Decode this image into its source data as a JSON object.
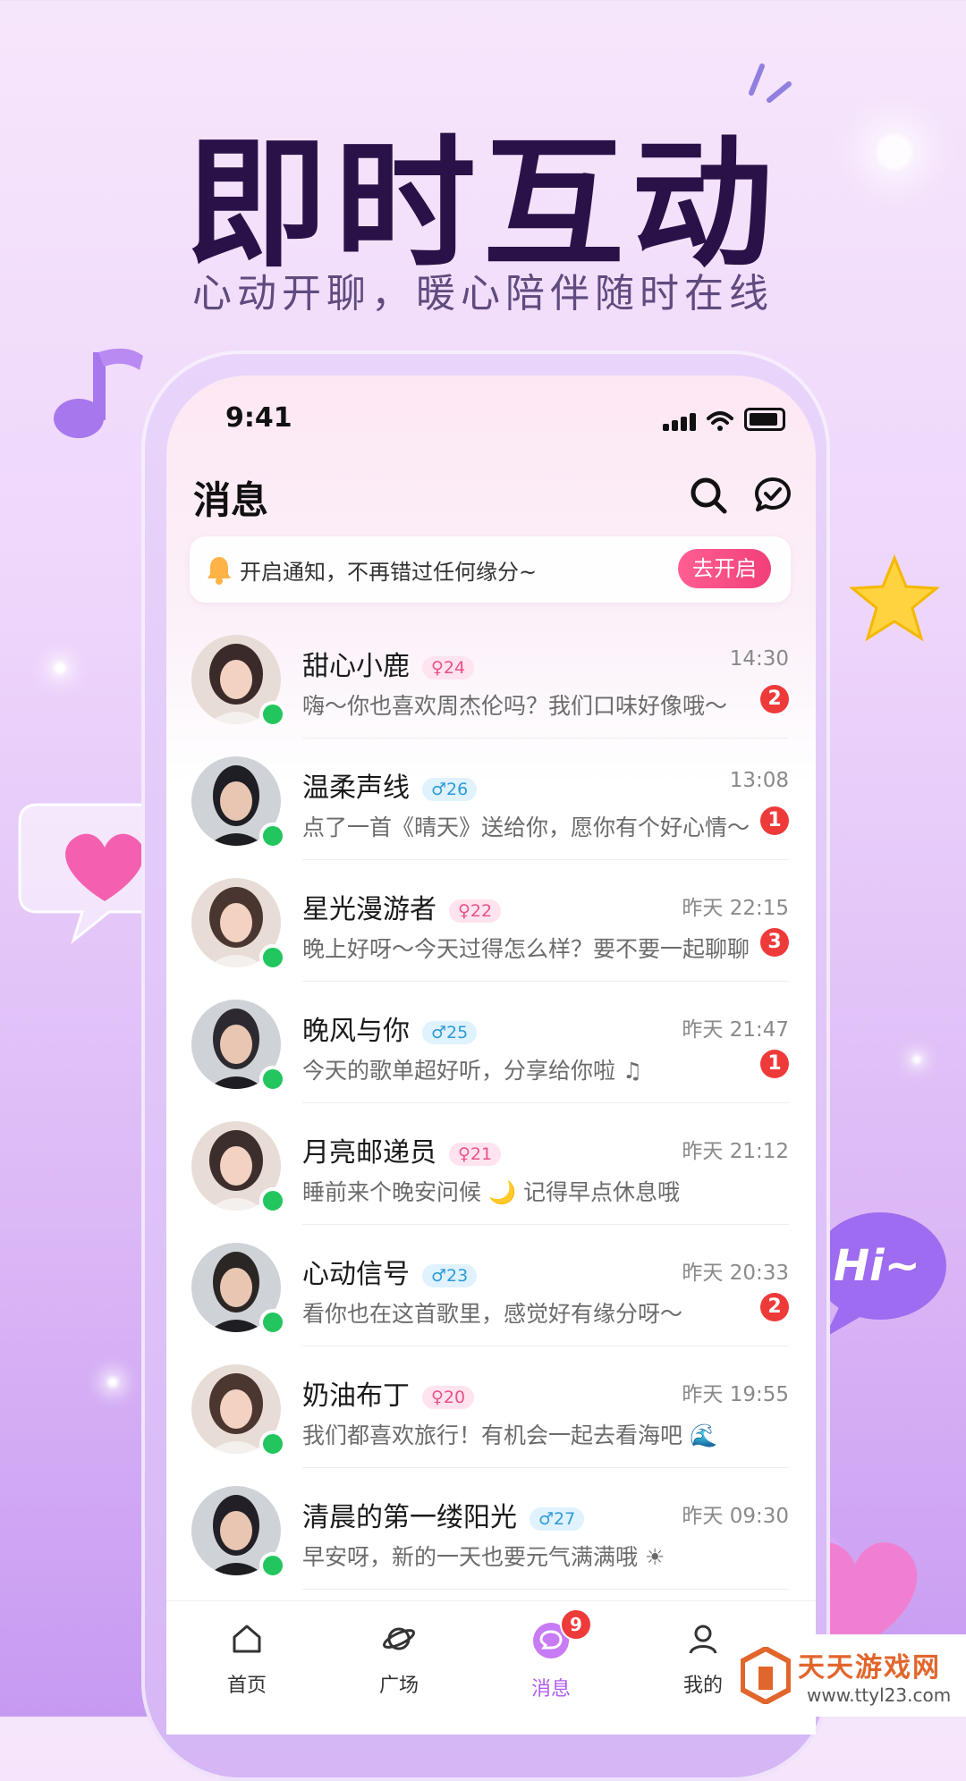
{
  "hero": {
    "title": "即时互动",
    "subtitle": "心动开聊，暖心陪伴随时在线"
  },
  "status_bar": {
    "time": "9:41"
  },
  "header": {
    "title": "消息"
  },
  "notice": {
    "text": "开启通知，不再错过任何缘分~",
    "button": "去开启"
  },
  "conversations": [
    {
      "name": "甜心小鹿",
      "gender": "female",
      "age": "24",
      "message": "嗨～你也喜欢周杰伦吗？我们口味好像哦～",
      "time": "14:30",
      "unread": "2"
    },
    {
      "name": "温柔声线",
      "gender": "male",
      "age": "26",
      "message": "点了一首《晴天》送给你，愿你有个好心情～",
      "time": "13:08",
      "unread": "1"
    },
    {
      "name": "星光漫游者",
      "gender": "female",
      "age": "22",
      "message": "晚上好呀～今天过得怎么样？要不要一起聊聊",
      "time": "昨天 22:15",
      "unread": "3"
    },
    {
      "name": "晚风与你",
      "gender": "male",
      "age": "25",
      "message": "今天的歌单超好听，分享给你啦 ♫",
      "time": "昨天 21:47",
      "unread": "1"
    },
    {
      "name": "月亮邮递员",
      "gender": "female",
      "age": "21",
      "message": "睡前来个晚安问候 🌙 记得早点休息哦",
      "time": "昨天 21:12",
      "unread": ""
    },
    {
      "name": "心动信号",
      "gender": "male",
      "age": "23",
      "message": "看你也在这首歌里，感觉好有缘分呀～",
      "time": "昨天 20:33",
      "unread": "2"
    },
    {
      "name": "奶油布丁",
      "gender": "female",
      "age": "20",
      "message": "我们都喜欢旅行！有机会一起去看海吧 🌊",
      "time": "昨天 19:55",
      "unread": ""
    },
    {
      "name": "清晨的第一缕阳光",
      "gender": "male",
      "age": "27",
      "message": "早安呀，新的一天也要元气满满哦 ☀",
      "time": "昨天 09:30",
      "unread": ""
    }
  ],
  "tabs": [
    {
      "label": "首页",
      "icon": "home-icon"
    },
    {
      "label": "广场",
      "icon": "planet-icon"
    },
    {
      "label": "消息",
      "icon": "message-icon",
      "badge": "9",
      "active": true
    },
    {
      "label": "我的",
      "icon": "profile-icon"
    }
  ],
  "decorations": {
    "hi_bubble": "Hi~"
  },
  "watermark": {
    "name": "天天游戏网",
    "url": "www.ttyl23.com"
  },
  "colors": {
    "accent": "#b15df0",
    "badge": "#ef3a3a",
    "online": "#22c55e",
    "button": "#f23f7a"
  }
}
